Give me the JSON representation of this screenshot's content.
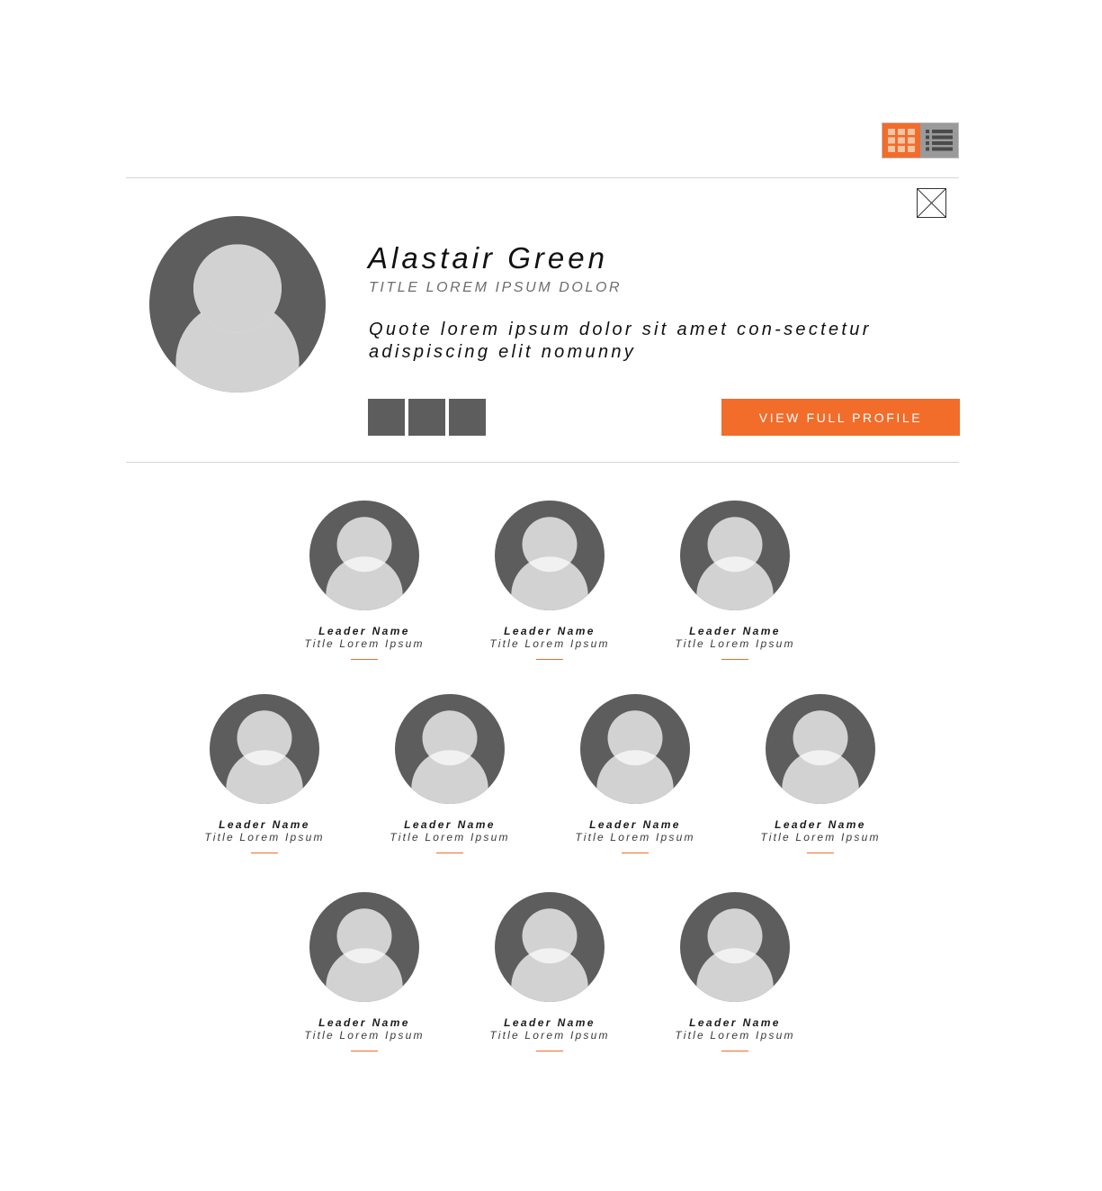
{
  "view_toggle": {
    "grid_icon": "grid-view-icon",
    "list_icon": "list-view-icon",
    "active": "grid",
    "accent_color": "#f26c2a"
  },
  "featured": {
    "name": "Alastair Green",
    "title": "TITLE LOREM IPSUM DOLOR",
    "quote": "Quote lorem ipsum dolor sit amet con-sectetur adispiscing elit nomunny",
    "cta_label": "VIEW FULL PROFILE",
    "close_icon": "close-icon",
    "social_icon_count": 3
  },
  "leaders": [
    {
      "name": "Leader Name",
      "title": "Title Lorem Ipsum"
    },
    {
      "name": "Leader Name",
      "title": "Title Lorem Ipsum"
    },
    {
      "name": "Leader Name",
      "title": "Title Lorem Ipsum"
    },
    {
      "name": "Leader Name",
      "title": "Title Lorem Ipsum"
    },
    {
      "name": "Leader Name",
      "title": "Title Lorem Ipsum"
    },
    {
      "name": "Leader Name",
      "title": "Title Lorem Ipsum"
    },
    {
      "name": "Leader Name",
      "title": "Title Lorem Ipsum"
    },
    {
      "name": "Leader Name",
      "title": "Title Lorem Ipsum"
    },
    {
      "name": "Leader Name",
      "title": "Title Lorem Ipsum"
    },
    {
      "name": "Leader Name",
      "title": "Title Lorem Ipsum"
    }
  ],
  "colors": {
    "accent": "#f26c2a",
    "avatar_dark": "#5c5d5c",
    "avatar_light": "#d3d2d2"
  }
}
